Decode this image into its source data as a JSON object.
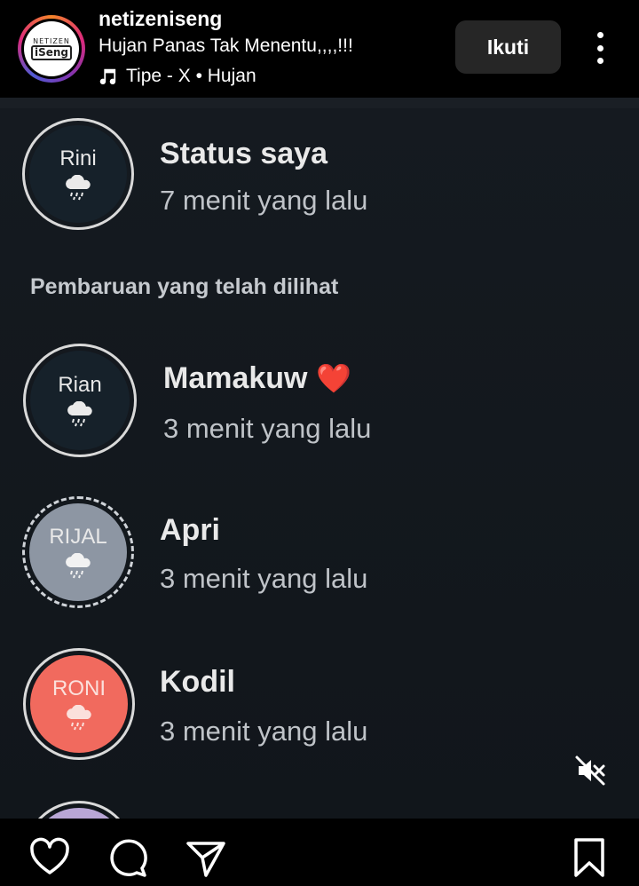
{
  "header": {
    "avatar_logo_line1": "NETIZEN",
    "avatar_logo_line2": "iSeng",
    "username": "netizeniseng",
    "caption": "Hujan Panas Tak Menentu,,,,!!!",
    "music": "Tipe - X • Hujan",
    "follow_label": "Ikuti",
    "icons": {
      "avatar": "profile-avatar",
      "music": "music-note-icon",
      "more": "more-vertical-icon"
    }
  },
  "post": {
    "my_status": {
      "avatar_name": "Rini",
      "title": "Status saya",
      "time": "7 menit yang lalu"
    },
    "section_label": "Pembaruan yang telah dilihat",
    "updates": [
      {
        "avatar_name": "Rian",
        "title": "Mamakuw",
        "emoji": "❤️",
        "time": "3 menit yang lalu",
        "avatar_color": "#16212a"
      },
      {
        "avatar_name": "RIJAL",
        "title": "Apri",
        "time": "3 menit yang lalu",
        "avatar_color": "#8d96a3"
      },
      {
        "avatar_name": "RONI",
        "title": "Kodil",
        "time": "3 menit yang lalu",
        "avatar_color": "#f16a5e"
      }
    ],
    "colors": {
      "ring": "#d9d9d9",
      "background": "#141920",
      "partial_avatar": "#b9a6d6"
    }
  },
  "actions": {
    "icons": [
      "heart-icon",
      "comment-icon",
      "share-icon",
      "bookmark-icon",
      "muted-speaker-icon"
    ]
  }
}
